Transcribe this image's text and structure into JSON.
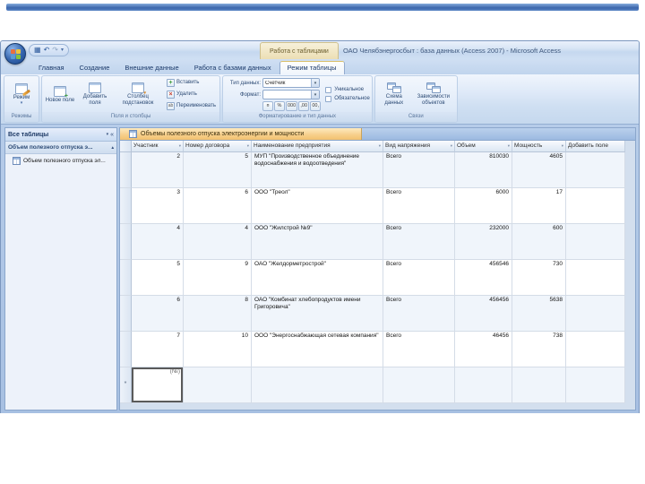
{
  "titlebar": {
    "context_group": "Работа с таблицами",
    "title": "ОАО Челябэнергосбыт : база данных (Access 2007) - Microsoft Access"
  },
  "ribbon": {
    "tabs": [
      {
        "label": "Главная"
      },
      {
        "label": "Создание"
      },
      {
        "label": "Внешние данные"
      },
      {
        "label": "Работа с базами данных"
      },
      {
        "label": "Режим таблицы"
      }
    ],
    "groups": {
      "views": {
        "label": "Режимы",
        "view_button": "Режим"
      },
      "fields": {
        "label": "Поля и столбцы",
        "new_field": "Новое поле",
        "add_fields": "Добавить поля",
        "lookup_column": "Столбец подстановок",
        "insert": "Вставить",
        "delete": "Удалить",
        "rename": "Переименовать"
      },
      "formatting": {
        "label": "Форматирование и тип данных",
        "datatype_label": "Тип данных:",
        "datatype_value": "Счетчик",
        "format_label": "Формат:",
        "format_value": "",
        "btn_currency": "¤",
        "btn_percent": "%",
        "btn_thousands": "000",
        "btn_dec_inc": ",00",
        "btn_dec_dec": "00,",
        "unique": "Уникальное",
        "required": "Обязательное"
      },
      "relationships": {
        "label": "Связи",
        "schema": "Схема данных",
        "dependencies": "Зависимости объектов"
      }
    }
  },
  "navpane": {
    "header": "Все таблицы",
    "group_title": "Объем полезного отпуска э...",
    "item": "Объем полезного отпуска эл..."
  },
  "document": {
    "tab_title": "Объемы полезного отпуска электроэнергии и мощности",
    "columns": [
      "Участник",
      "Номер договора",
      "Наименование предприятия",
      "Вид напряжения",
      "Объем",
      "Мощность",
      "Добавить поле"
    ],
    "rows": [
      {
        "participant": "2",
        "contract": "5",
        "company": "МУП \"Производственное объединение водоснабжения и водоотведения\"",
        "type": "Всего",
        "volume": "810030",
        "power": "4605"
      },
      {
        "participant": "3",
        "contract": "6",
        "company": "ООО \"Треол\"",
        "type": "Всего",
        "volume": "6000",
        "power": "17"
      },
      {
        "participant": "4",
        "contract": "4",
        "company": "ООО \"Жилстрой №9\"",
        "type": "Всего",
        "volume": "232000",
        "power": "600"
      },
      {
        "participant": "5",
        "contract": "9",
        "company": "ОАО \"Желдорметрострой\"",
        "type": "Всего",
        "volume": "456546",
        "power": "730"
      },
      {
        "participant": "6",
        "contract": "8",
        "company": "ОАО \"Комбинат хлебопродуктов имени Григоровича\"",
        "type": "Всего",
        "volume": "456456",
        "power": "5638"
      },
      {
        "participant": "7",
        "contract": "10",
        "company": "ООО \"Энергоснабжающая сетевая компания\"",
        "type": "Всего",
        "volume": "46456",
        "power": "738"
      }
    ],
    "new_row": {
      "selector": "*",
      "autonumber": "(№)"
    }
  },
  "icons": {
    "save": "▦",
    "undo": "↶",
    "redo": "↷",
    "dropdown": "▾",
    "collapse_left": "«",
    "group_collapse": "▴",
    "insert_plus": "+",
    "delete_x": "×",
    "rename_ab": "ab"
  }
}
